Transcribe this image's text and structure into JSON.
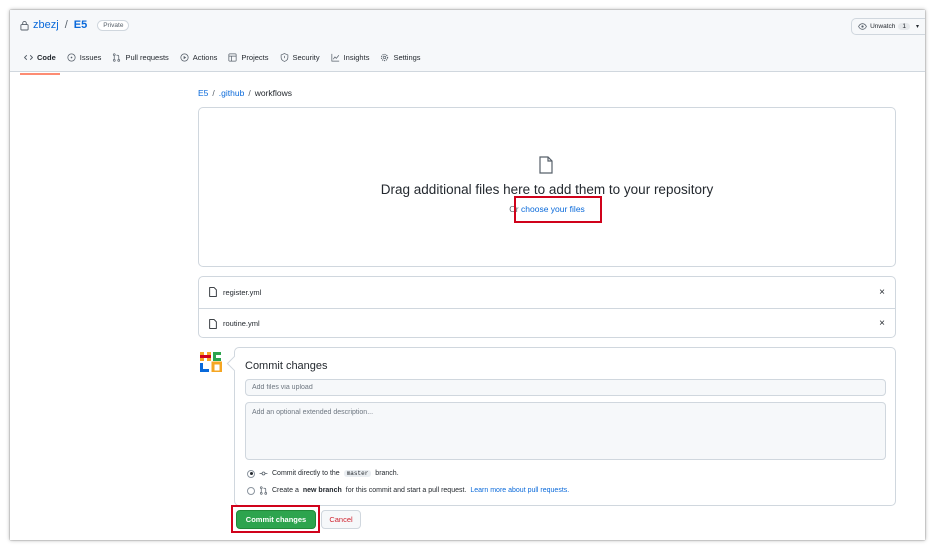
{
  "header": {
    "owner": "zbezj",
    "separator": "/",
    "repo": "E5",
    "visibility_badge": "Private",
    "watch": {
      "label": "Unwatch",
      "count": "1",
      "icon": "eye-icon"
    }
  },
  "tabs": [
    {
      "label": "Code",
      "icon": "code-icon",
      "active": true
    },
    {
      "label": "Issues",
      "icon": "issue-icon"
    },
    {
      "label": "Pull requests",
      "icon": "pull-request-icon"
    },
    {
      "label": "Actions",
      "icon": "play-icon"
    },
    {
      "label": "Projects",
      "icon": "table-icon"
    },
    {
      "label": "Security",
      "icon": "shield-icon"
    },
    {
      "label": "Insights",
      "icon": "graph-icon"
    },
    {
      "label": "Settings",
      "icon": "gear-icon"
    }
  ],
  "breadcrumb": {
    "root": "E5",
    "sep": "/",
    "folder": ".github",
    "current": "workflows"
  },
  "dropzone": {
    "title": "Drag additional files here to add them to your repository",
    "or_text": "Or",
    "choose_link": "choose your files",
    "icon": "file-icon"
  },
  "files": [
    {
      "name": "register.yml",
      "remove": "×"
    },
    {
      "name": "routine.yml",
      "remove": "×"
    }
  ],
  "commit": {
    "title": "Commit changes",
    "summary_placeholder": "Add files via upload",
    "description_placeholder": "Add an optional extended description...",
    "option_direct": {
      "prefix": "Commit directly to the",
      "branch": "master",
      "suffix": "branch.",
      "checked": true
    },
    "option_new": {
      "prefix": "Create a",
      "bold": "new branch",
      "suffix": "for this commit and start a pull request.",
      "link": "Learn more about pull requests.",
      "checked": false
    },
    "commit_button": "Commit changes",
    "cancel_button": "Cancel"
  },
  "colors": {
    "link": "#0969da",
    "primary_button": "#2da44e",
    "danger": "#cf222e",
    "highlight": "#d0021b",
    "active_tab": "#fd8c73"
  }
}
